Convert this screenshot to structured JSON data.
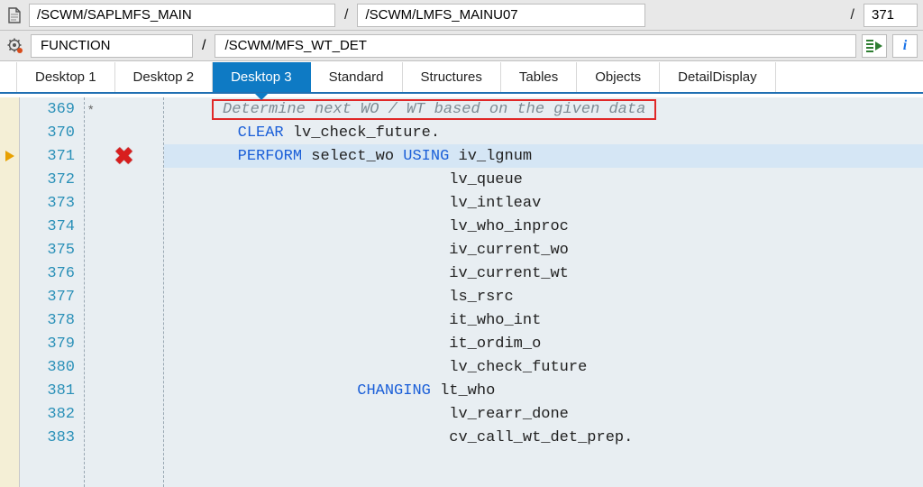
{
  "topbar": {
    "program_include": "/SCWM/SAPLMFS_MAIN",
    "include": "/SCWM/LMFS_MAINU07",
    "line": "371"
  },
  "secondbar": {
    "type": "FUNCTION",
    "object": "/SCWM/MFS_WT_DET"
  },
  "tabs": [
    {
      "label": "Desktop 1"
    },
    {
      "label": "Desktop 2"
    },
    {
      "label": "Desktop 3",
      "active": true
    },
    {
      "label": "Standard"
    },
    {
      "label": "Structures"
    },
    {
      "label": "Tables"
    },
    {
      "label": "Objects"
    },
    {
      "label": "DetailDisplay"
    }
  ],
  "code": {
    "current_line": 371,
    "breakpoint_line": 371,
    "lines": [
      {
        "n": 369,
        "star": true,
        "comment": "Determine next WO / WT based on the given data",
        "boxed": true
      },
      {
        "n": 370,
        "tokens": [
          {
            "t": "kw",
            "s": "CLEAR "
          },
          {
            "t": "plain",
            "s": "lv_check_future."
          }
        ]
      },
      {
        "n": 371,
        "tokens": [
          {
            "t": "kw",
            "s": "PERFORM "
          },
          {
            "t": "plain",
            "s": "select_wo "
          },
          {
            "t": "kw",
            "s": "USING "
          },
          {
            "t": "plain",
            "s": "iv_lgnum"
          }
        ],
        "highlight": true
      },
      {
        "n": 372,
        "indent_param": "lv_queue"
      },
      {
        "n": 373,
        "indent_param": "lv_intleav"
      },
      {
        "n": 374,
        "indent_param": "lv_who_inproc"
      },
      {
        "n": 375,
        "indent_param": "iv_current_wo"
      },
      {
        "n": 376,
        "indent_param": "iv_current_wt"
      },
      {
        "n": 377,
        "indent_param": "ls_rsrc"
      },
      {
        "n": 378,
        "indent_param": "it_who_int"
      },
      {
        "n": 379,
        "indent_param": "it_ordim_o"
      },
      {
        "n": 380,
        "indent_param": "lv_check_future"
      },
      {
        "n": 381,
        "changing": "CHANGING",
        "indent_param": "lt_who"
      },
      {
        "n": 382,
        "indent_param": "lv_rearr_done"
      },
      {
        "n": 383,
        "indent_param": "cv_call_wt_det_prep."
      }
    ]
  },
  "icons": {
    "doc": "document-icon",
    "gear": "gear-icon",
    "exec": "execute-icon",
    "info": "i"
  }
}
